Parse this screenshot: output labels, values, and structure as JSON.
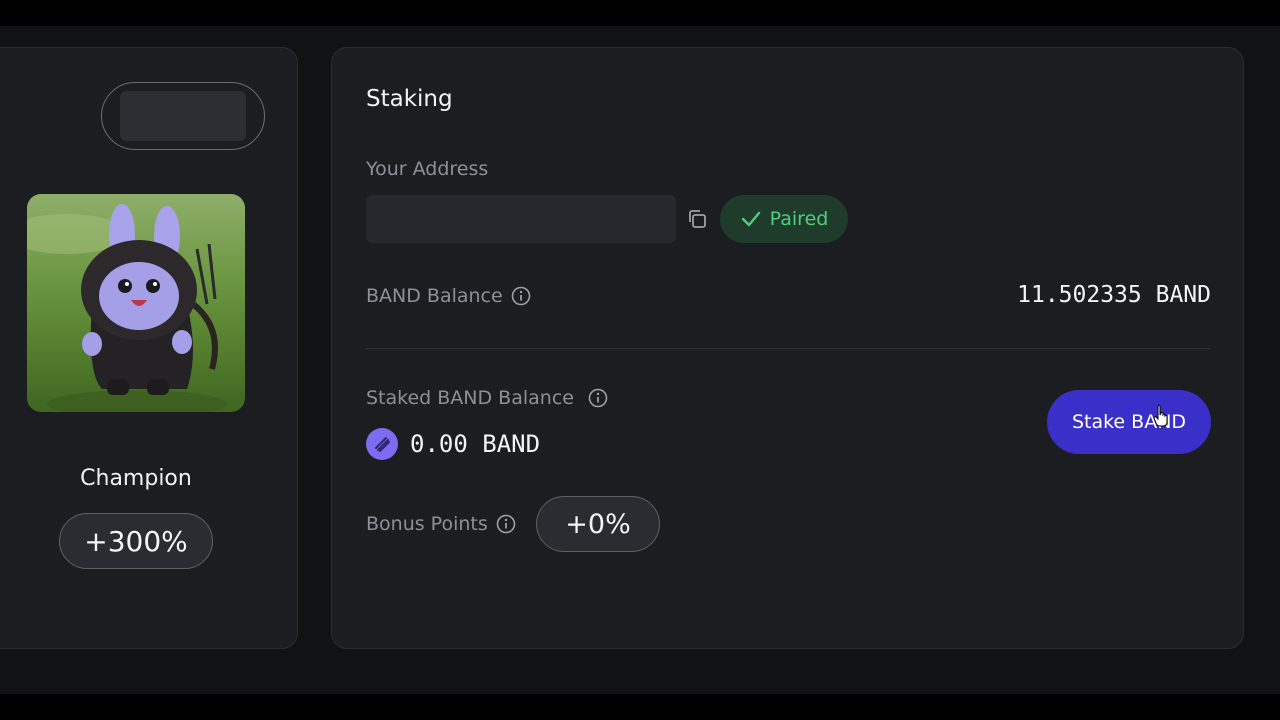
{
  "left_panel": {
    "label": "Champion",
    "bonus": "+300%"
  },
  "staking": {
    "title": "Staking",
    "address_label": "Your Address",
    "paired_label": "Paired",
    "band_balance_label": "BAND Balance",
    "band_balance_value": "11.502335 BAND",
    "staked_label": "Staked BAND Balance",
    "staked_value": "0.00 BAND",
    "stake_button": "Stake BAND",
    "bonus_label": "Bonus Points",
    "bonus_value": "+0%"
  },
  "colors": {
    "accent": "#3b2fc9",
    "paired_green": "#4fcf7e",
    "band_logo": "#7b6cf0"
  },
  "icons": [
    "copy-icon",
    "check-icon",
    "info-icon",
    "band-logo-icon",
    "hand-cursor-icon"
  ]
}
